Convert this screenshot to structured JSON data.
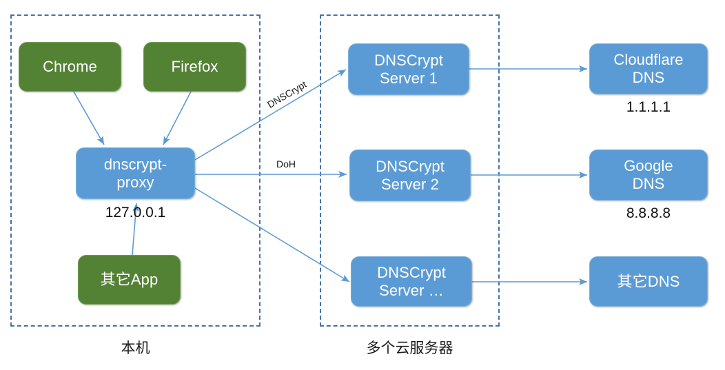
{
  "diagram": {
    "title": "dnscrypt-proxy DNS encryption flow",
    "colors": {
      "green_node": "#548235",
      "blue_node": "#5B9BD5",
      "dashed_border": "#4472A8",
      "arrow": "#5B9BD5",
      "text_dark": "#111111"
    },
    "zones": [
      {
        "id": "local",
        "label": "本机"
      },
      {
        "id": "cloud",
        "label": "多个云服务器"
      }
    ],
    "nodes": [
      {
        "id": "chrome",
        "label": "Chrome",
        "color": "green"
      },
      {
        "id": "firefox",
        "label": "Firefox",
        "color": "green"
      },
      {
        "id": "other-app",
        "label": "其它App",
        "color": "green"
      },
      {
        "id": "dnscrypt-proxy",
        "label": "dnscrypt-\nproxy",
        "color": "blue"
      },
      {
        "id": "server-1",
        "label": "DNSCrypt\nServer 1",
        "color": "blue"
      },
      {
        "id": "server-2",
        "label": "DNSCrypt\nServer 2",
        "color": "blue"
      },
      {
        "id": "server-n",
        "label": "DNSCrypt\nServer …",
        "color": "blue"
      },
      {
        "id": "cloudflare",
        "label": "Cloudflare\nDNS",
        "color": "blue"
      },
      {
        "id": "google",
        "label": "Google\nDNS",
        "color": "blue"
      },
      {
        "id": "other-dns",
        "label": "其它DNS",
        "color": "blue"
      }
    ],
    "captions": [
      {
        "id": "proxy-address",
        "text": "127.0.0.1"
      },
      {
        "id": "cloudflare-address",
        "text": "1.1.1.1"
      },
      {
        "id": "google-address",
        "text": "8.8.8.8"
      }
    ],
    "edge_labels": [
      {
        "id": "dnscrypt-protocol",
        "text": "DNSCrypt"
      },
      {
        "id": "doh-protocol",
        "text": "DoH"
      }
    ]
  }
}
